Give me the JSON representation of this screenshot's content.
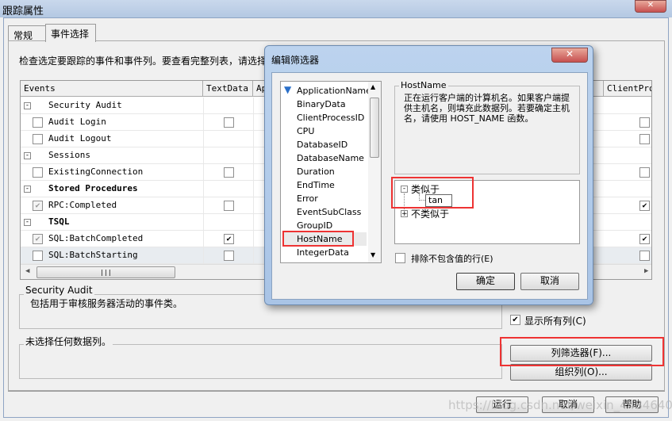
{
  "window": {
    "title": "跟踪属性"
  },
  "tabs": [
    {
      "label": "常规",
      "active": false
    },
    {
      "label": "事件选择",
      "active": true
    }
  ],
  "description": "检查选定要跟踪的事件和事件列。要查看完整列表，请选择",
  "grid": {
    "columns": [
      "Events",
      "TextData",
      "Ap",
      "ClientProc"
    ],
    "rows": [
      {
        "type": "group",
        "label": "Security Audit",
        "bold": false
      },
      {
        "type": "event",
        "label": "Audit Login",
        "checked": false,
        "textdata": false,
        "clientproc": false
      },
      {
        "type": "event",
        "label": "Audit Logout",
        "checked": false,
        "textdata": null,
        "clientproc": false
      },
      {
        "type": "group",
        "label": "Sessions",
        "bold": false
      },
      {
        "type": "event",
        "label": "ExistingConnection",
        "checked": false,
        "textdata": false,
        "clientproc": false
      },
      {
        "type": "group",
        "label": "Stored Procedures",
        "bold": true
      },
      {
        "type": "event",
        "label": "RPC:Completed",
        "checked": true,
        "textdata": false,
        "clientproc": true
      },
      {
        "type": "group",
        "label": "TSQL",
        "bold": true
      },
      {
        "type": "event",
        "label": "SQL:BatchCompleted",
        "checked": true,
        "textdata": true,
        "clientproc": true
      },
      {
        "type": "event",
        "label": "SQL:BatchStarting",
        "checked": false,
        "textdata": false,
        "clientproc": false,
        "selected": true
      }
    ]
  },
  "event_info": {
    "title": "Security Audit",
    "text": "包括用于审核服务器活动的事件类。"
  },
  "column_info": {
    "title": "未选择任何数据列。"
  },
  "show_all_columns": {
    "label": "显示所有列(C)",
    "checked": true
  },
  "buttons": {
    "column_filter": "列筛选器(F)...",
    "organize_columns": "组织列(O)...",
    "run": "运行",
    "cancel": "取消",
    "help": "帮助"
  },
  "filter_dialog": {
    "title": "编辑筛选器",
    "columns": [
      "ApplicationName",
      "BinaryData",
      "ClientProcessID",
      "CPU",
      "DatabaseID",
      "DatabaseName",
      "Duration",
      "EndTime",
      "Error",
      "EventSubClass",
      "GroupID",
      "HostName",
      "IntegerData"
    ],
    "selected": "HostName",
    "info_title": "HostName",
    "info_text": "正在运行客户端的计算机名。如果客户端提供主机名，则填充此数据列。若要确定主机名，请使用 HOST_NAME 函数。",
    "tree": {
      "like": "类似于",
      "like_value": "tan",
      "not_like": "不类似于"
    },
    "exclude_label": "排除不包含值的行(E)",
    "exclude_checked": false,
    "ok": "确定",
    "cancel": "取消"
  },
  "watermark": "https://blog.csdn.net/weixin_44846406",
  "colors": {
    "highlight": "#e33333",
    "title_bar": "#b4c8e2"
  }
}
